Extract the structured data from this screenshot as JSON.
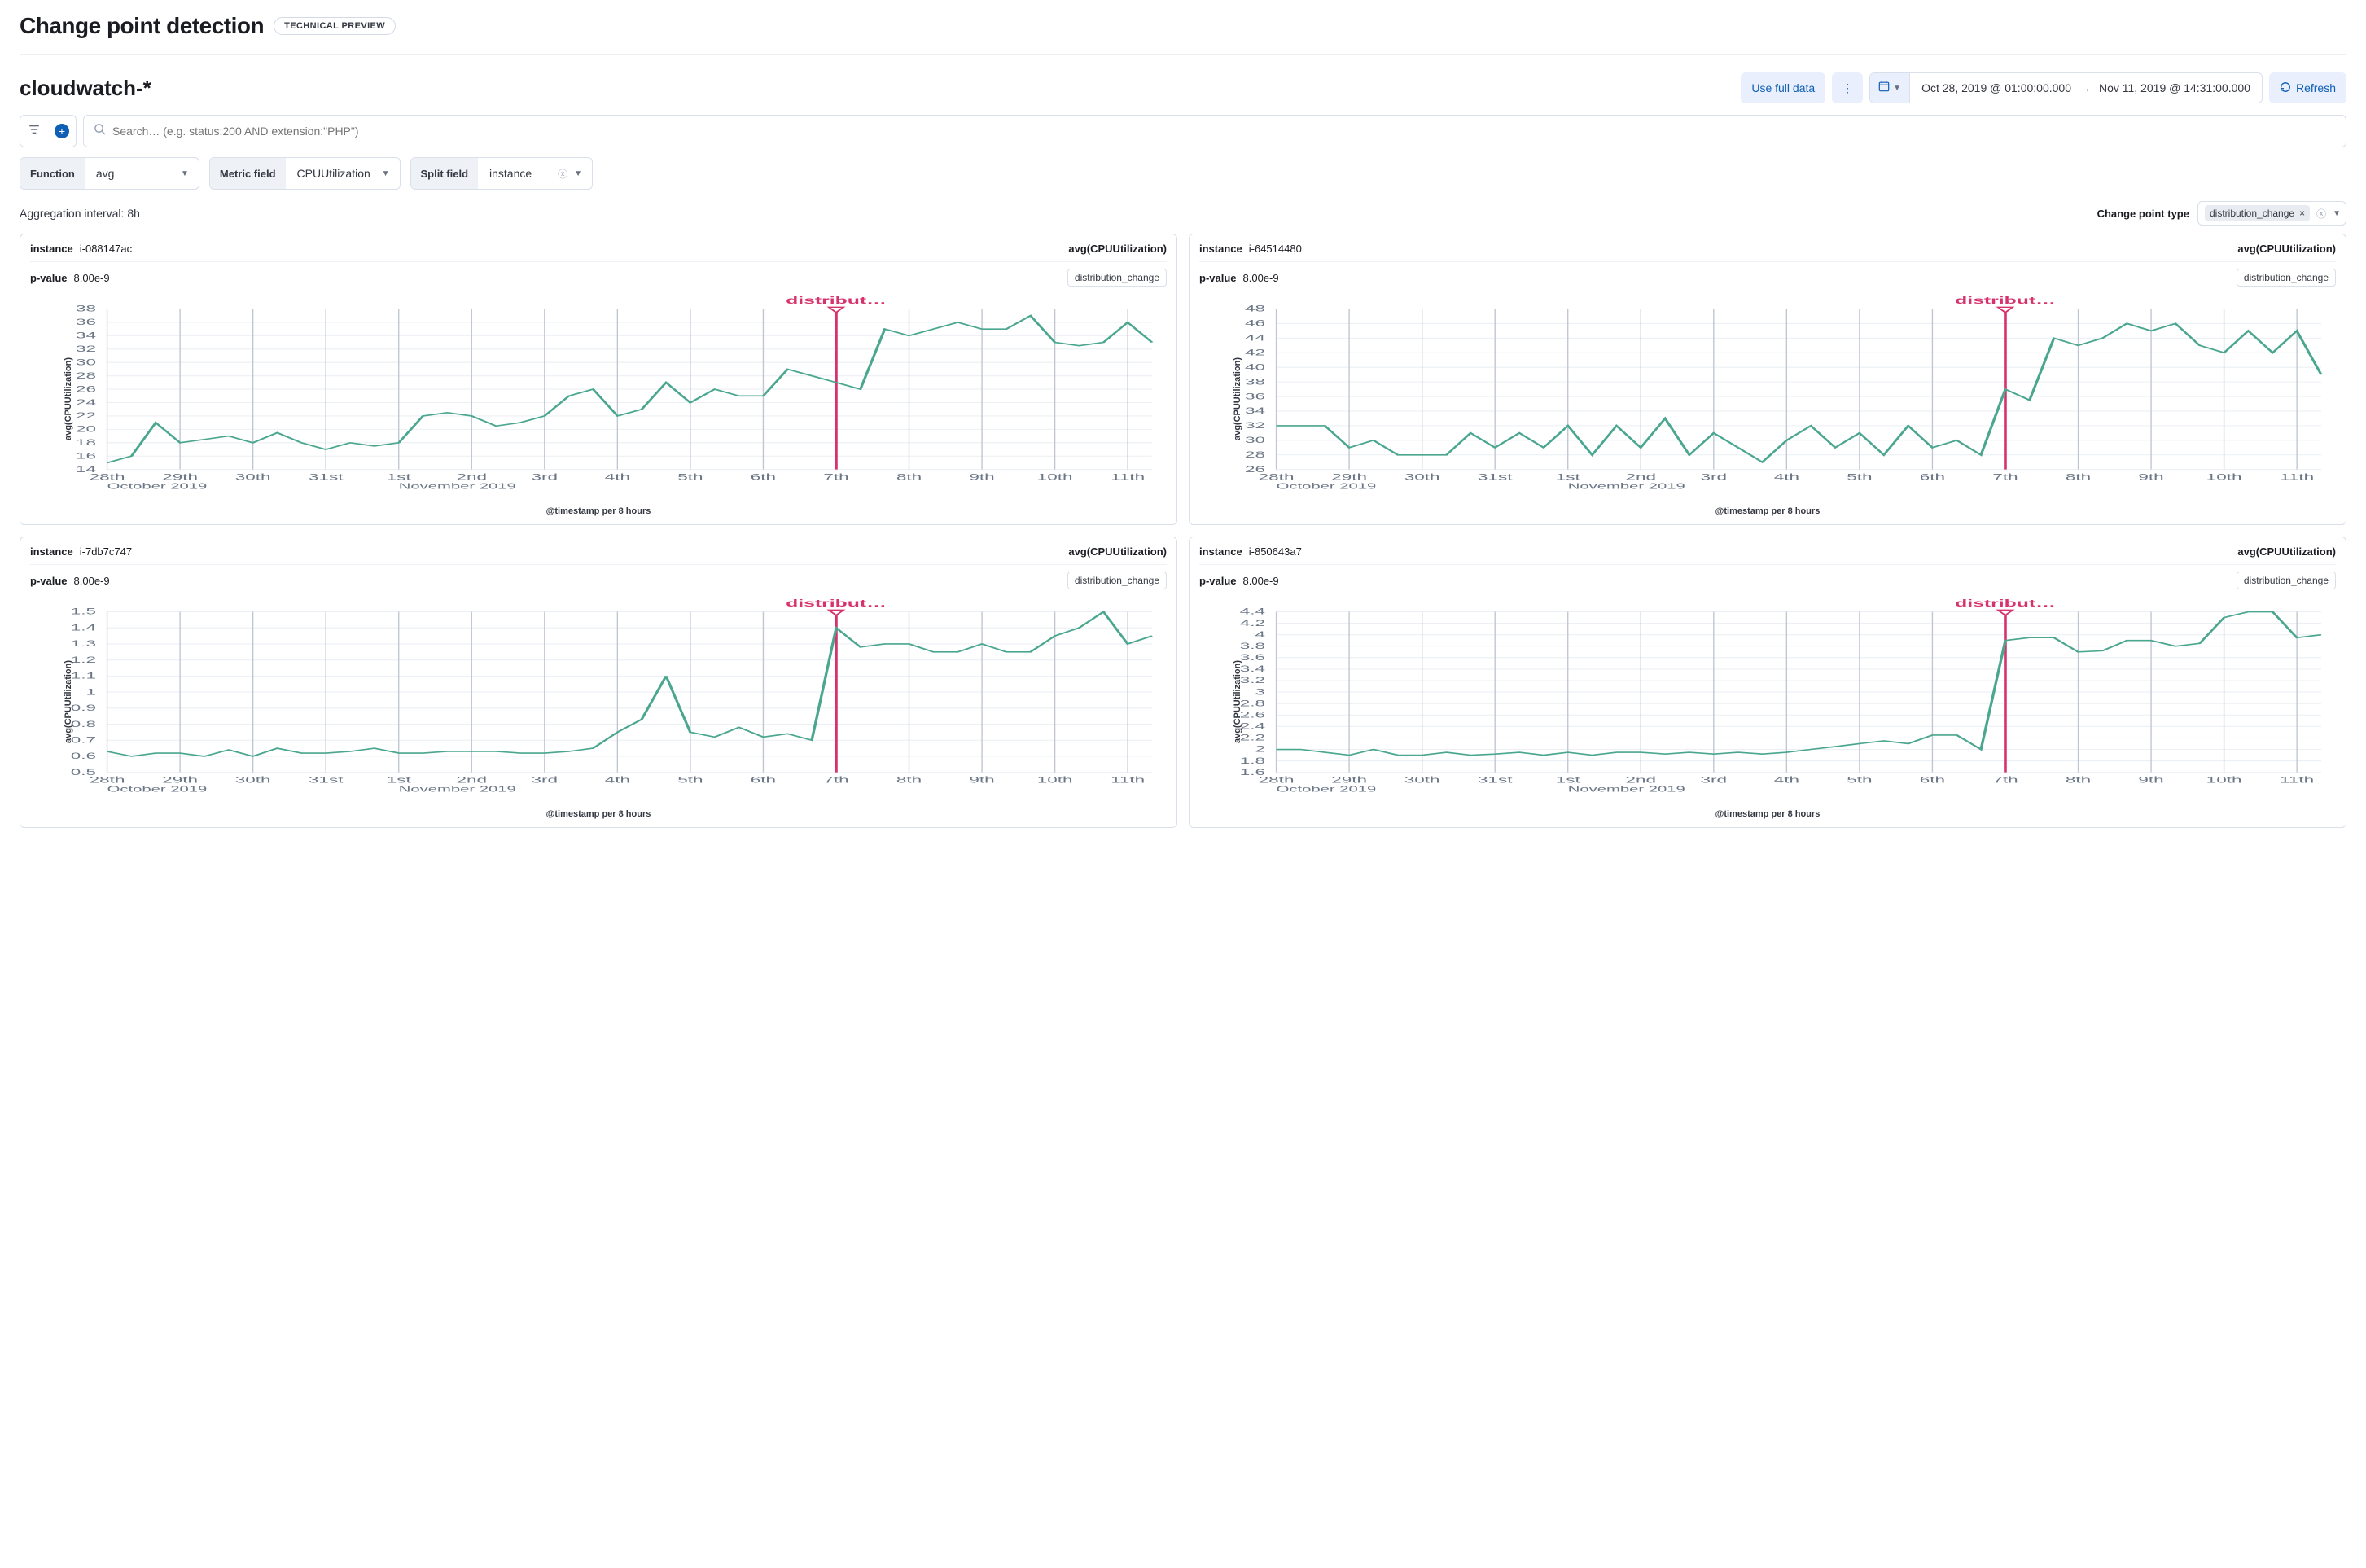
{
  "header": {
    "title": "Change point detection",
    "preview_badge": "TECHNICAL PREVIEW"
  },
  "dataview": "cloudwatch-*",
  "toolbar": {
    "use_full_data": "Use full data",
    "date_from": "Oct 28, 2019 @ 01:00:00.000",
    "date_to": "Nov 11, 2019 @ 14:31:00.000",
    "refresh": "Refresh"
  },
  "search": {
    "placeholder": "Search… (e.g. status:200 AND extension:\"PHP\")"
  },
  "controls": {
    "function_label": "Function",
    "function_value": "avg",
    "metric_label": "Metric field",
    "metric_value": "CPUUtilization",
    "split_label": "Split field",
    "split_value": "instance"
  },
  "aggregation_interval_label": "Aggregation interval:",
  "aggregation_interval_value": "8h",
  "cp_type": {
    "label": "Change point type",
    "chip": "distribution_change"
  },
  "panel_labels": {
    "instance": "instance",
    "metric": "avg(CPUUtilization)",
    "pvalue": "p-value",
    "annotation": "distribut…",
    "xlabel": "@timestamp per 8 hours",
    "ylabel": "avg(CPUUtilization)"
  },
  "x_categories": [
    "28th",
    "29th",
    "30th",
    "31st",
    "1st",
    "2nd",
    "3rd",
    "4th",
    "5th",
    "6th",
    "7th",
    "8th",
    "9th",
    "10th",
    "11th"
  ],
  "x_sublabels": {
    "0": "October 2019",
    "4": "November 2019"
  },
  "panels": [
    {
      "instance": "i-088147ac",
      "pvalue": "8.00e-9",
      "tag": "distribution_change",
      "ylim": [
        14,
        38
      ],
      "yticks": [
        14,
        16,
        18,
        20,
        22,
        24,
        26,
        28,
        30,
        32,
        34,
        36,
        38
      ],
      "change_index": 30,
      "values": [
        15,
        16,
        21,
        18,
        18.5,
        19,
        18,
        19.5,
        18,
        17,
        18,
        17.5,
        18,
        22,
        22.5,
        22,
        20.5,
        21,
        22,
        25,
        26,
        22,
        23,
        27,
        24,
        26,
        25,
        25,
        29,
        28,
        27,
        26,
        35,
        34,
        35,
        36,
        35,
        35,
        37,
        33,
        32.5,
        33,
        36,
        33
      ]
    },
    {
      "instance": "i-64514480",
      "pvalue": "8.00e-9",
      "tag": "distribution_change",
      "ylim": [
        26,
        48
      ],
      "yticks": [
        26,
        28,
        30,
        32,
        34,
        36,
        38,
        40,
        42,
        44,
        46,
        48
      ],
      "change_index": 30,
      "values": [
        32,
        32,
        32,
        29,
        30,
        28,
        28,
        28,
        31,
        29,
        31,
        29,
        32,
        28,
        32,
        29,
        33,
        28,
        31,
        29,
        27,
        30,
        32,
        29,
        31,
        28,
        32,
        29,
        30,
        28,
        37,
        35.5,
        44,
        43,
        44,
        46,
        45,
        46,
        43,
        42,
        45,
        42,
        45,
        39
      ]
    },
    {
      "instance": "i-7db7c747",
      "pvalue": "8.00e-9",
      "tag": "distribution_change",
      "ylim": [
        0.5,
        1.5
      ],
      "yticks": [
        0.5,
        0.6,
        0.7,
        0.8,
        0.9,
        1.0,
        1.1,
        1.2,
        1.3,
        1.4,
        1.5
      ],
      "change_index": 30,
      "values": [
        0.63,
        0.6,
        0.62,
        0.62,
        0.6,
        0.64,
        0.6,
        0.65,
        0.62,
        0.62,
        0.63,
        0.65,
        0.62,
        0.62,
        0.63,
        0.63,
        0.63,
        0.62,
        0.62,
        0.63,
        0.65,
        0.75,
        0.83,
        1.1,
        0.75,
        0.72,
        0.78,
        0.72,
        0.74,
        0.7,
        1.4,
        1.28,
        1.3,
        1.3,
        1.25,
        1.25,
        1.3,
        1.25,
        1.25,
        1.35,
        1.4,
        1.5,
        1.3,
        1.35
      ]
    },
    {
      "instance": "i-850643a7",
      "pvalue": "8.00e-9",
      "tag": "distribution_change",
      "ylim": [
        1.6,
        4.4
      ],
      "yticks": [
        1.6,
        1.8,
        2.0,
        2.2,
        2.4,
        2.6,
        2.8,
        3.0,
        3.2,
        3.4,
        3.6,
        3.8,
        4.0,
        4.2,
        4.4
      ],
      "change_index": 30,
      "values": [
        2.0,
        2.0,
        1.95,
        1.9,
        2.0,
        1.9,
        1.9,
        1.95,
        1.9,
        1.92,
        1.95,
        1.9,
        1.95,
        1.9,
        1.95,
        1.95,
        1.92,
        1.95,
        1.92,
        1.95,
        1.92,
        1.95,
        2.0,
        2.05,
        2.1,
        2.15,
        2.1,
        2.25,
        2.25,
        2.0,
        3.9,
        3.95,
        3.95,
        3.7,
        3.72,
        3.9,
        3.9,
        3.8,
        3.85,
        4.3,
        4.4,
        4.4,
        3.95,
        4.0
      ]
    }
  ],
  "chart_data": [
    {
      "type": "line",
      "title": "instance i-088147ac — avg(CPUUtilization)",
      "xlabel": "@timestamp per 8 hours",
      "ylabel": "avg(CPUUtilization)",
      "ylim": [
        14,
        38
      ],
      "categories_note": "44 8-hour buckets from 2019-10-28 to 2019-11-11",
      "values": [
        15,
        16,
        21,
        18,
        18.5,
        19,
        18,
        19.5,
        18,
        17,
        18,
        17.5,
        18,
        22,
        22.5,
        22,
        20.5,
        21,
        22,
        25,
        26,
        22,
        23,
        27,
        24,
        26,
        25,
        25,
        29,
        28,
        27,
        26,
        35,
        34,
        35,
        36,
        35,
        35,
        37,
        33,
        32.5,
        33,
        36,
        33
      ],
      "annotations": [
        {
          "type": "vertical_line",
          "label": "distribution_change",
          "index": 30
        }
      ]
    },
    {
      "type": "line",
      "title": "instance i-64514480 — avg(CPUUtilization)",
      "xlabel": "@timestamp per 8 hours",
      "ylabel": "avg(CPUUtilization)",
      "ylim": [
        26,
        48
      ],
      "values": [
        32,
        32,
        32,
        29,
        30,
        28,
        28,
        28,
        31,
        29,
        31,
        29,
        32,
        28,
        32,
        29,
        33,
        28,
        31,
        29,
        27,
        30,
        32,
        29,
        31,
        28,
        32,
        29,
        30,
        28,
        37,
        35.5,
        44,
        43,
        44,
        46,
        45,
        46,
        43,
        42,
        45,
        42,
        45,
        39
      ],
      "annotations": [
        {
          "type": "vertical_line",
          "label": "distribution_change",
          "index": 30
        }
      ]
    },
    {
      "type": "line",
      "title": "instance i-7db7c747 — avg(CPUUtilization)",
      "xlabel": "@timestamp per 8 hours",
      "ylabel": "avg(CPUUtilization)",
      "ylim": [
        0.5,
        1.5
      ],
      "values": [
        0.63,
        0.6,
        0.62,
        0.62,
        0.6,
        0.64,
        0.6,
        0.65,
        0.62,
        0.62,
        0.63,
        0.65,
        0.62,
        0.62,
        0.63,
        0.63,
        0.63,
        0.62,
        0.62,
        0.63,
        0.65,
        0.75,
        0.83,
        1.1,
        0.75,
        0.72,
        0.78,
        0.72,
        0.74,
        0.7,
        1.4,
        1.28,
        1.3,
        1.3,
        1.25,
        1.25,
        1.3,
        1.25,
        1.25,
        1.35,
        1.4,
        1.5,
        1.3,
        1.35
      ],
      "annotations": [
        {
          "type": "vertical_line",
          "label": "distribution_change",
          "index": 30
        }
      ]
    },
    {
      "type": "line",
      "title": "instance i-850643a7 — avg(CPUUtilization)",
      "xlabel": "@timestamp per 8 hours",
      "ylabel": "avg(CPUUtilization)",
      "ylim": [
        1.6,
        4.4
      ],
      "values": [
        2.0,
        2.0,
        1.95,
        1.9,
        2.0,
        1.9,
        1.9,
        1.95,
        1.9,
        1.92,
        1.95,
        1.9,
        1.95,
        1.9,
        1.95,
        1.95,
        1.92,
        1.95,
        1.92,
        1.95,
        1.92,
        1.95,
        2.0,
        2.05,
        2.1,
        2.15,
        2.1,
        2.25,
        2.25,
        2.0,
        3.9,
        3.95,
        3.95,
        3.7,
        3.72,
        3.9,
        3.9,
        3.8,
        3.85,
        4.3,
        4.4,
        4.4,
        3.95,
        4.0
      ],
      "annotations": [
        {
          "type": "vertical_line",
          "label": "distribution_change",
          "index": 30
        }
      ]
    }
  ]
}
